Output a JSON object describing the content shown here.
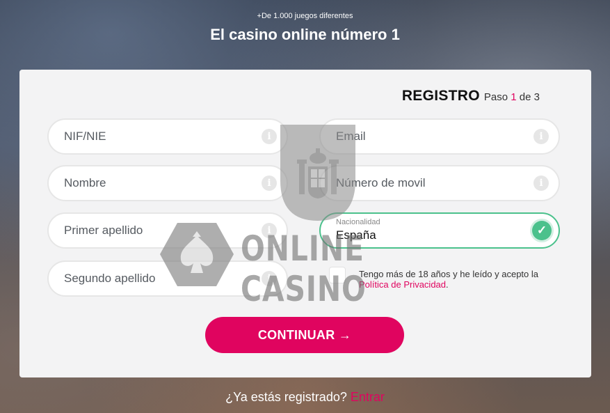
{
  "header": {
    "subtitle": "+De 1.000 juegos diferentes",
    "title": "El casino online número 1"
  },
  "registro": {
    "title": "REGISTRO",
    "step_prefix": "Paso",
    "step_current": "1",
    "step_of": "de 3"
  },
  "form": {
    "nif": {
      "placeholder": "NIF/NIE"
    },
    "nombre": {
      "placeholder": "Nombre"
    },
    "primer_apellido": {
      "placeholder": "Primer apellido"
    },
    "segundo_apellido": {
      "placeholder": "Segundo apellido"
    },
    "email": {
      "placeholder": "Email"
    },
    "movil": {
      "placeholder": "Número de movil"
    },
    "nacionalidad": {
      "label": "Nacionalidad",
      "value": "España"
    },
    "terms": {
      "text_before": "Tengo más de 18 años y he leído y acepto la",
      "link": "Política de Privacidad",
      "text_after": ".",
      "checked": false
    },
    "continue_label": "CONTINUAR →"
  },
  "footer": {
    "question": "¿Ya estás registrado?",
    "login_link": "Entrar"
  },
  "watermark": {
    "text": "ONLINE CASINO"
  },
  "icons": {
    "info": "info-icon",
    "check": "check-icon",
    "arrow": "arrow-right-icon"
  },
  "colors": {
    "accent": "#e0045f",
    "valid": "#4bc18c",
    "card_bg": "#f3f3f4"
  }
}
